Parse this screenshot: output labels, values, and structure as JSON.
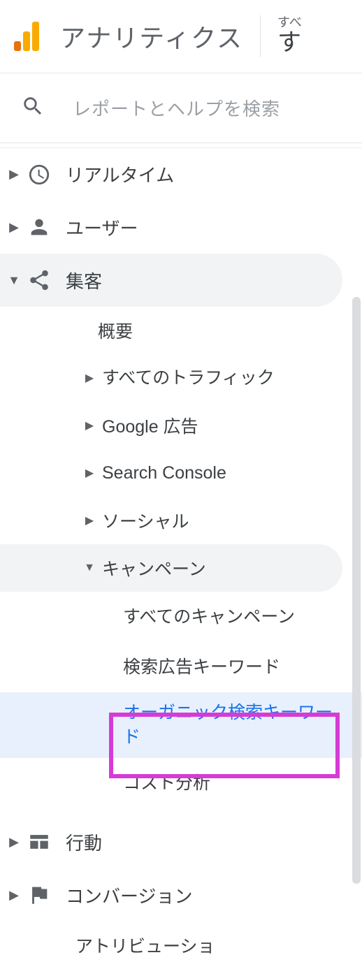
{
  "header": {
    "app_title": "アナリティクス",
    "right_line1": "すべ",
    "right_line2": "す"
  },
  "search": {
    "placeholder": "レポートとヘルプを検索"
  },
  "nav": {
    "realtime": "リアルタイム",
    "audience": "ユーザー",
    "acquisition": "集客",
    "overview": "概要",
    "all_traffic": "すべてのトラフィック",
    "google_ads": "Google 広告",
    "search_console": "Search Console",
    "social": "ソーシャル",
    "campaigns": "キャンペーン",
    "all_campaigns": "すべてのキャンペーン",
    "paid_keywords": "検索広告キーワード",
    "organic_keywords": "オーガニック検索キーワード",
    "cost_analysis": "コスト分析",
    "behavior": "行動",
    "conversions": "コンバージョン",
    "attribution": "アトリビューショ"
  }
}
